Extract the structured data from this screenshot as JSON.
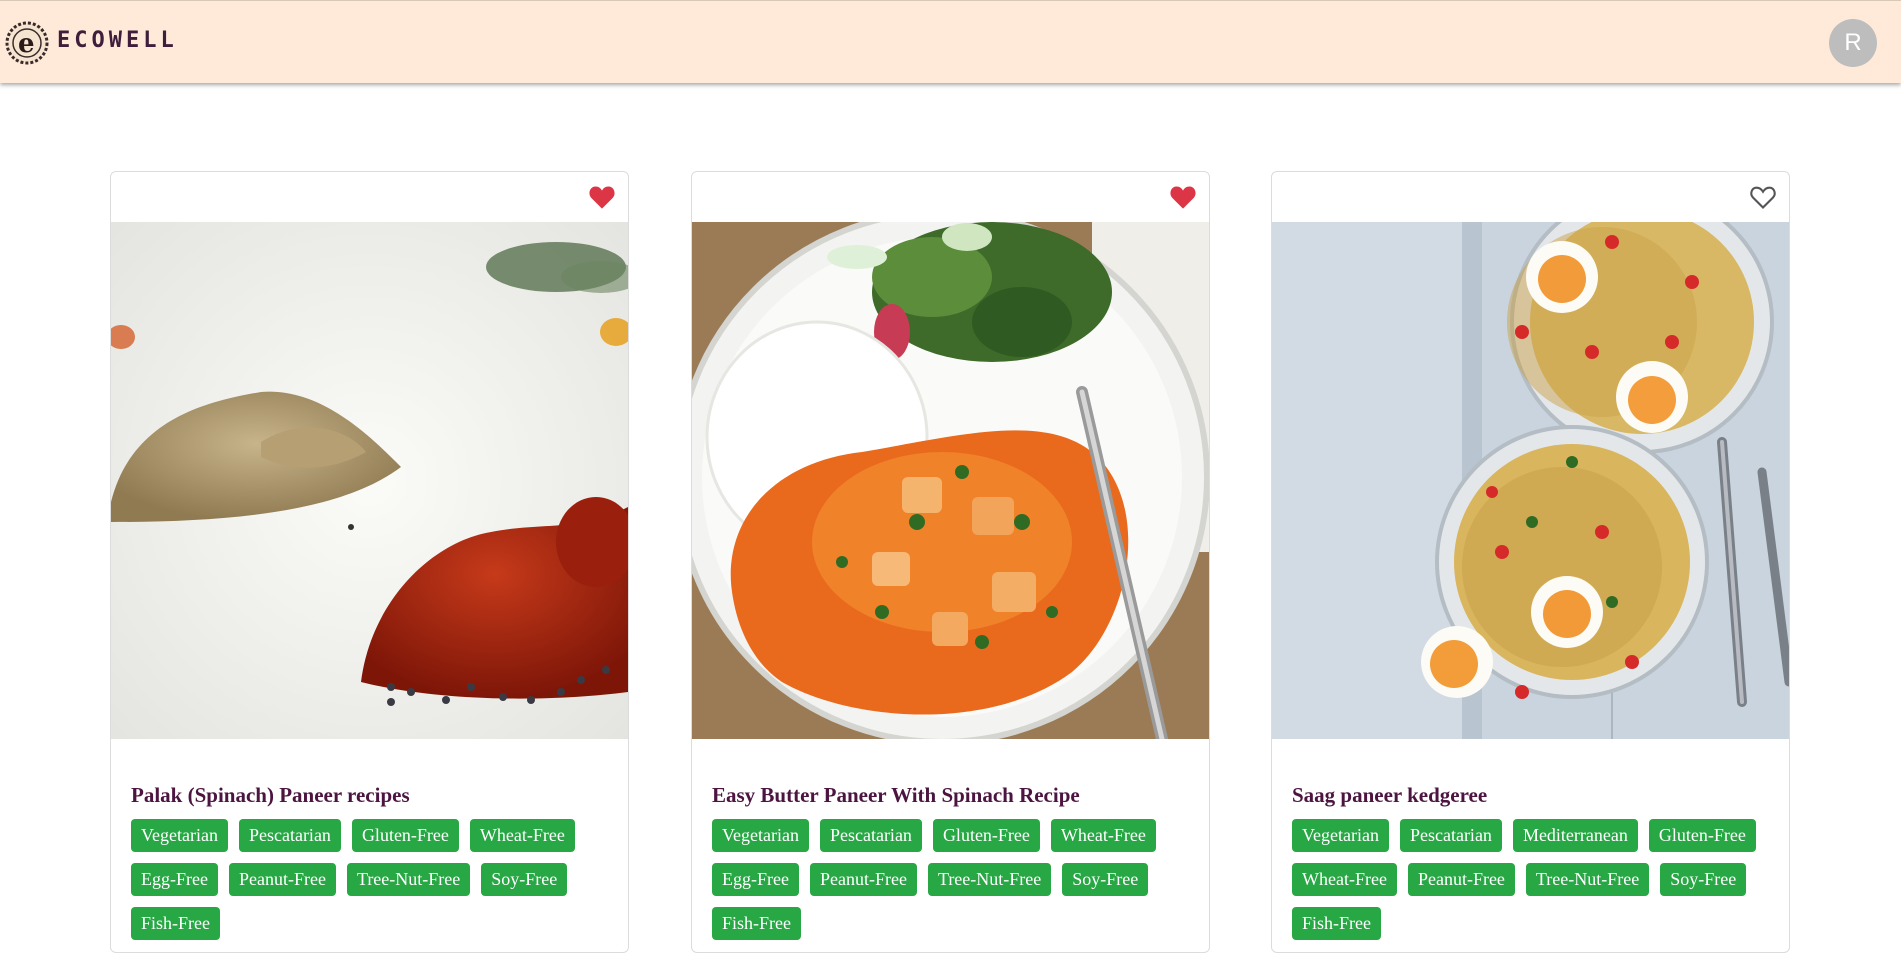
{
  "header": {
    "brand": "ECOWELL",
    "avatar_initial": "R"
  },
  "colors": {
    "header_bg": "#ffeada",
    "title": "#4c1440",
    "tag_bg": "#28a745",
    "heart_filled": "#dc3545",
    "heart_outline": "#555555"
  },
  "recipes": [
    {
      "title": "Palak (Spinach) Paneer recipes",
      "favorited": true,
      "image": "spice-piles-photo",
      "tags": [
        "Vegetarian",
        "Pescatarian",
        "Gluten-Free",
        "Wheat-Free",
        "Egg-Free",
        "Peanut-Free",
        "Tree-Nut-Free",
        "Soy-Free",
        "Fish-Free"
      ]
    },
    {
      "title": "Easy Butter Paneer With Spinach Recipe",
      "favorited": true,
      "image": "butter-paneer-plate-photo",
      "tags": [
        "Vegetarian",
        "Pescatarian",
        "Gluten-Free",
        "Wheat-Free",
        "Egg-Free",
        "Peanut-Free",
        "Tree-Nut-Free",
        "Soy-Free",
        "Fish-Free"
      ]
    },
    {
      "title": "Saag paneer kedgeree",
      "favorited": false,
      "image": "kedgeree-bowls-photo",
      "tags": [
        "Vegetarian",
        "Pescatarian",
        "Mediterranean",
        "Gluten-Free",
        "Wheat-Free",
        "Peanut-Free",
        "Tree-Nut-Free",
        "Soy-Free",
        "Fish-Free"
      ]
    }
  ]
}
